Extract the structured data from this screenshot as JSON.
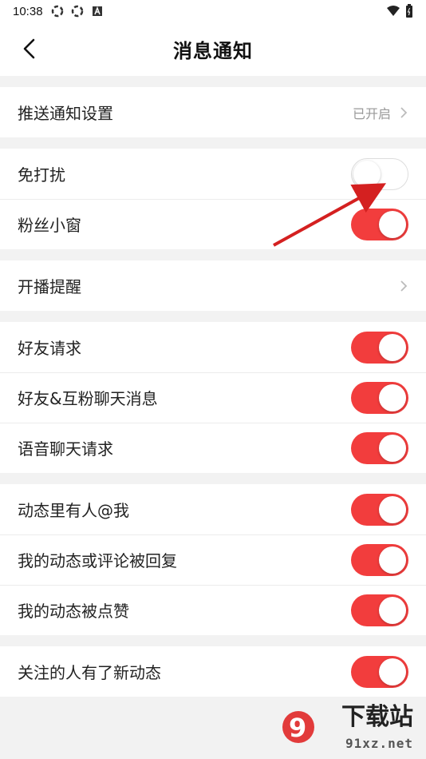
{
  "status_bar": {
    "time": "10:38"
  },
  "header": {
    "title": "消息通知"
  },
  "groups": [
    {
      "rows": [
        {
          "label": "推送通知设置",
          "value": "已开启",
          "kind": "chevron"
        }
      ]
    },
    {
      "rows": [
        {
          "label": "免打扰",
          "kind": "toggle",
          "on": false
        },
        {
          "label": "粉丝小窗",
          "kind": "toggle",
          "on": true
        }
      ]
    },
    {
      "rows": [
        {
          "label": "开播提醒",
          "kind": "chevron"
        }
      ]
    },
    {
      "rows": [
        {
          "label": "好友请求",
          "kind": "toggle",
          "on": true
        },
        {
          "label": "好友&互粉聊天消息",
          "kind": "toggle",
          "on": true
        },
        {
          "label": "语音聊天请求",
          "kind": "toggle",
          "on": true
        }
      ]
    },
    {
      "rows": [
        {
          "label": "动态里有人@我",
          "kind": "toggle",
          "on": true
        },
        {
          "label": "我的动态或评论被回复",
          "kind": "toggle",
          "on": true
        },
        {
          "label": "我的动态被点赞",
          "kind": "toggle",
          "on": true
        }
      ]
    },
    {
      "rows": [
        {
          "label": "关注的人有了新动态",
          "kind": "toggle",
          "on": true
        }
      ]
    }
  ],
  "watermark": {
    "brand": "下载站",
    "domain": "91xz.net",
    "logo_text": "9"
  },
  "colors": {
    "accent": "#f23d3d",
    "annotation_arrow": "#d42020"
  }
}
